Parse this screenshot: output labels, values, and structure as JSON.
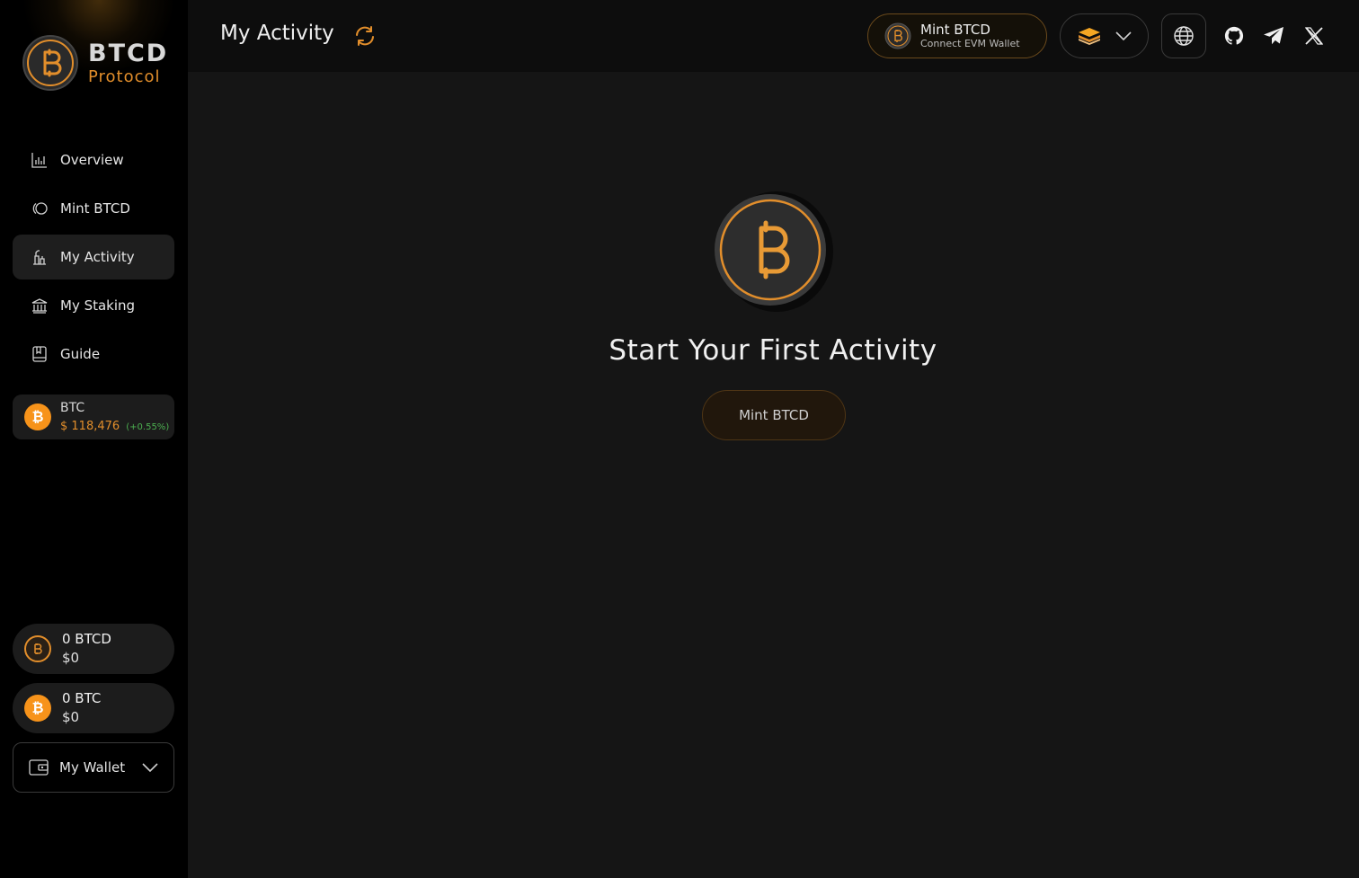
{
  "brand": {
    "title": "BTCD",
    "subtitle": "Protocol"
  },
  "sidebar": {
    "items": [
      {
        "label": "Overview",
        "icon": "bar-chart-icon"
      },
      {
        "label": "Mint BTCD",
        "icon": "mint-icon"
      },
      {
        "label": "My Activity",
        "icon": "activity-icon",
        "active": true
      },
      {
        "label": "My Staking",
        "icon": "bank-icon"
      },
      {
        "label": "Guide",
        "icon": "book-icon"
      }
    ],
    "price": {
      "symbol": "BTC",
      "value": "$ 118,476",
      "change": "(+0.55%)"
    },
    "balances": [
      {
        "amount": "0 BTCD",
        "usd": "$0",
        "icon": "btcd-coin-icon"
      },
      {
        "amount": "0 BTC",
        "usd": "$0",
        "icon": "btc-coin-icon"
      }
    ],
    "wallet_label": "My Wallet"
  },
  "header": {
    "title": "My Activity",
    "connect": {
      "line1": "Mint BTCD",
      "line2": "Connect EVM Wallet"
    }
  },
  "main": {
    "empty_title": "Start Your First Activity",
    "cta_label": "Mint BTCD"
  },
  "colors": {
    "accent": "#e28e2b",
    "btc": "#f7931a",
    "positive": "#4caf50",
    "background": "#151515",
    "sidebar": "#000000"
  }
}
